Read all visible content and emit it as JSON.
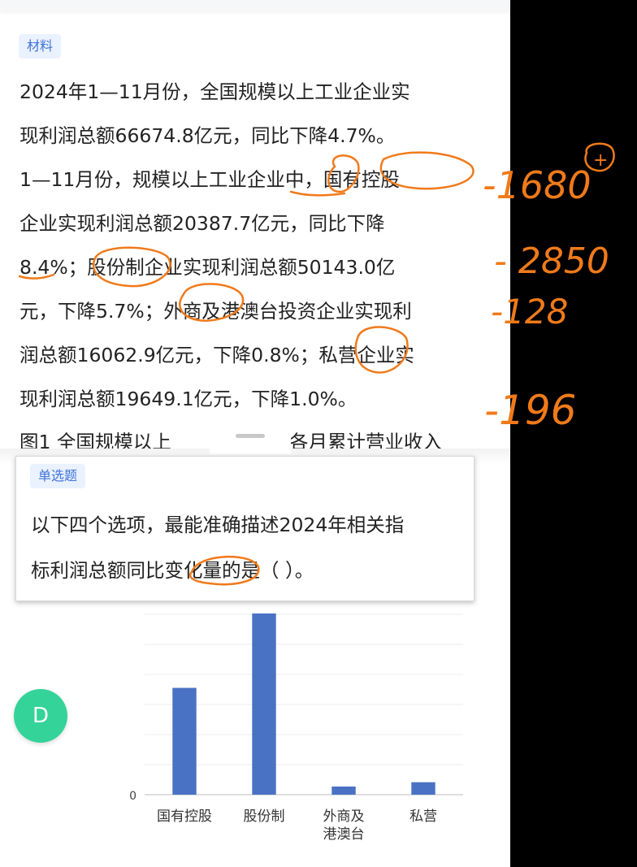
{
  "material": {
    "tag": "材料",
    "lines": [
      "2024年1—11月份，全国规模以上工业企业实",
      "现利润总额66674.8亿元，同比下降4.7%。",
      "1—11月份，规模以上工业企业中，国有控股",
      "企业实现利润总额20387.7亿元，同比下降",
      "8.4%；股份制企业实现利润总额50143.0亿",
      "元，下降5.7%；外商及港澳台投资企业实现利",
      "润总额16062.9亿元，下降0.8%；私营企业实",
      "现利润总额19649.1亿元，下降1.0%。"
    ],
    "figure_caption_left": "图1  全国规模以上",
    "figure_caption_right": "各月累计营业收入"
  },
  "question": {
    "tag": "单选题",
    "line1": "以下四个选项，最能准确描述2024年相关指",
    "line2": "标利润总额同比变化量的是（    ）。"
  },
  "fab": {
    "label": "D"
  },
  "handwriting": {
    "note1": "-1680",
    "plus": "+",
    "note2": "- 2850",
    "note3": "-128",
    "note4": "-196"
  },
  "chart_data": {
    "type": "bar",
    "categories": [
      "国有控股",
      "股份制",
      "外商及\n港澳台",
      "私营"
    ],
    "category_lines": [
      [
        "国有控股"
      ],
      [
        "股份制"
      ],
      [
        "外商及",
        "港澳台"
      ],
      [
        "私营"
      ]
    ],
    "values": [
      1680,
      2850,
      128,
      196
    ],
    "ytick_labels": [
      "0"
    ],
    "bar_color": "#4a72c4",
    "grid": true
  },
  "colors": {
    "accent": "#3f74d8",
    "ink": "#f07a1a",
    "fab": "#34d39a"
  }
}
